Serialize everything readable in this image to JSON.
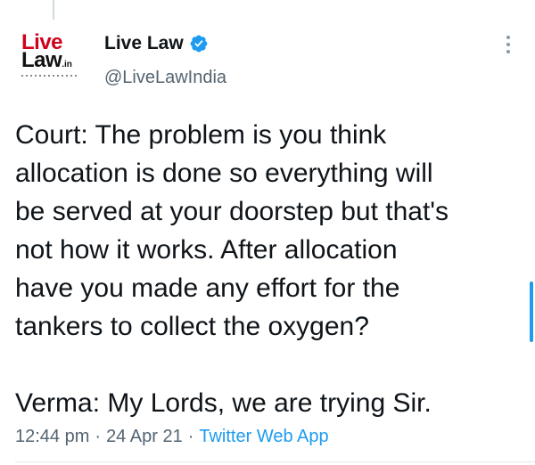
{
  "avatar": {
    "brand_line1": "Live",
    "brand_line2": "Law",
    "brand_suffix": ".in"
  },
  "author": {
    "display_name": "Live Law",
    "handle": "@LiveLawIndia",
    "verified": true
  },
  "tweet": {
    "paragraph_1": "Court: The problem is you think\nallocation is done so everything will\nbe served at your doorstep but that's\nnot how it works. After allocation\nhave you made any effort for the\ntankers to collect the oxygen?",
    "paragraph_2": "Verma: My Lords, we are trying Sir.",
    "time": "12:44 pm",
    "date": "24 Apr 21",
    "separator": "·",
    "source": "Twitter Web App"
  },
  "icons": {
    "verified": "verified-badge-icon",
    "more": "more-options-icon"
  },
  "colors": {
    "brand_red": "#d0021b",
    "twitter_blue": "#1d9bf0",
    "muted_text": "#536471",
    "body_text": "#0f1419"
  }
}
